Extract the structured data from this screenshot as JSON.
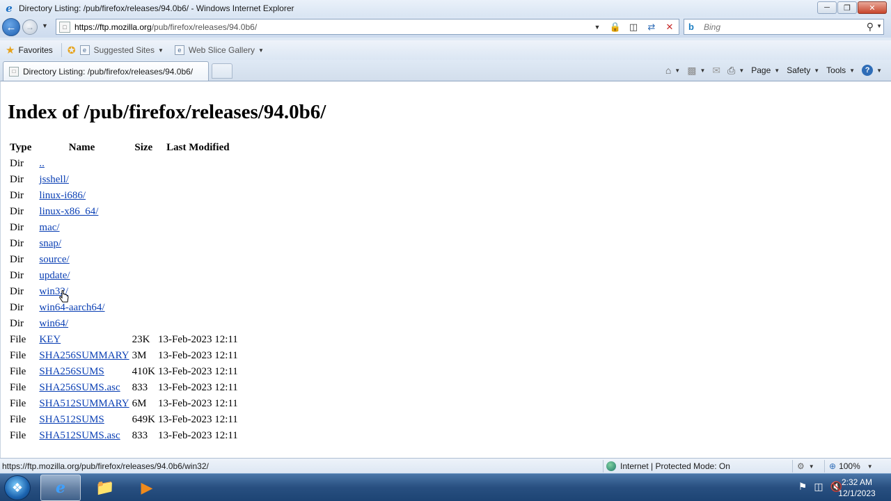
{
  "window": {
    "title": "Directory Listing: /pub/firefox/releases/94.0b6/ - Windows Internet Explorer",
    "minimize_label": "─",
    "maximize_label": "❐",
    "close_label": "✕"
  },
  "address_bar": {
    "url_host": "https://ftp.mozilla.org",
    "url_path": "/pub/firefox/releases/94.0b6/"
  },
  "search": {
    "placeholder": "Bing"
  },
  "favorites_bar": {
    "favorites_label": "Favorites",
    "suggested_sites_label": "Suggested Sites",
    "web_slice_gallery_label": "Web Slice Gallery"
  },
  "tab": {
    "label": "Directory Listing: /pub/firefox/releases/94.0b6/"
  },
  "command_bar": {
    "page_label": "Page",
    "safety_label": "Safety",
    "tools_label": "Tools"
  },
  "page": {
    "heading": "Index of /pub/firefox/releases/94.0b6/",
    "columns": {
      "type": "Type",
      "name": "Name",
      "size": "Size",
      "last_modified": "Last Modified"
    },
    "rows": [
      {
        "type": "Dir",
        "name": "..",
        "size": "",
        "modified": ""
      },
      {
        "type": "Dir",
        "name": "jsshell/",
        "size": "",
        "modified": ""
      },
      {
        "type": "Dir",
        "name": "linux-i686/",
        "size": "",
        "modified": ""
      },
      {
        "type": "Dir",
        "name": "linux-x86_64/",
        "size": "",
        "modified": ""
      },
      {
        "type": "Dir",
        "name": "mac/",
        "size": "",
        "modified": ""
      },
      {
        "type": "Dir",
        "name": "snap/",
        "size": "",
        "modified": ""
      },
      {
        "type": "Dir",
        "name": "source/",
        "size": "",
        "modified": ""
      },
      {
        "type": "Dir",
        "name": "update/",
        "size": "",
        "modified": ""
      },
      {
        "type": "Dir",
        "name": "win32/",
        "size": "",
        "modified": ""
      },
      {
        "type": "Dir",
        "name": "win64-aarch64/",
        "size": "",
        "modified": ""
      },
      {
        "type": "Dir",
        "name": "win64/",
        "size": "",
        "modified": ""
      },
      {
        "type": "File",
        "name": "KEY",
        "size": "23K",
        "modified": "13-Feb-2023 12:11"
      },
      {
        "type": "File",
        "name": "SHA256SUMMARY",
        "size": "3M",
        "modified": "13-Feb-2023 12:11"
      },
      {
        "type": "File",
        "name": "SHA256SUMS",
        "size": "410K",
        "modified": "13-Feb-2023 12:11"
      },
      {
        "type": "File",
        "name": "SHA256SUMS.asc",
        "size": "833",
        "modified": "13-Feb-2023 12:11"
      },
      {
        "type": "File",
        "name": "SHA512SUMMARY",
        "size": "6M",
        "modified": "13-Feb-2023 12:11"
      },
      {
        "type": "File",
        "name": "SHA512SUMS",
        "size": "649K",
        "modified": "13-Feb-2023 12:11"
      },
      {
        "type": "File",
        "name": "SHA512SUMS.asc",
        "size": "833",
        "modified": "13-Feb-2023 12:11"
      }
    ]
  },
  "status_bar": {
    "url": "https://ftp.mozilla.org/pub/firefox/releases/94.0b6/win32/",
    "zone": "Internet | Protected Mode: On",
    "zoom": "100%"
  },
  "taskbar": {
    "time": "2:32 AM",
    "date": "12/1/2023"
  },
  "colors": {
    "link": "#0a3fb4",
    "chrome_bg": "#dfe9f5"
  }
}
